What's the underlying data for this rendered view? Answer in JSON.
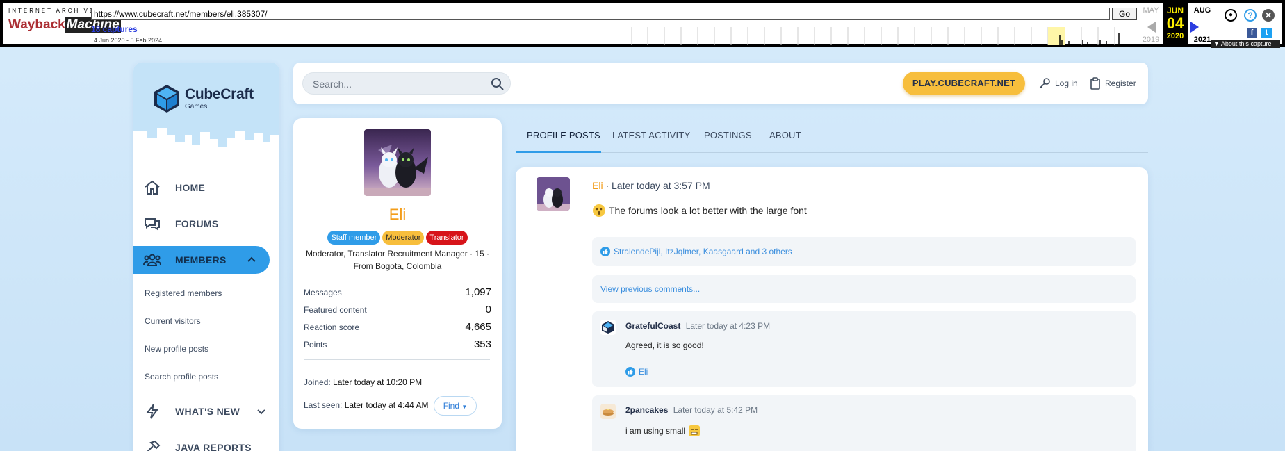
{
  "wayback": {
    "brand_top": "INTERNET ARCHIVE",
    "brand_word1": "Wayback",
    "brand_word2": "Machine",
    "url": "https://www.cubecraft.net/members/eli.385307/",
    "go_label": "Go",
    "captures": "18 captures",
    "date_range": "4 Jun 2020 - 5 Feb 2024",
    "prev_month": "MAY",
    "prev_year": "2019",
    "cur_month": "JUN",
    "cur_day": "04",
    "cur_year": "2020",
    "next_month": "AUG",
    "next_year": "2021",
    "about": "▼ About this capture",
    "icons": [
      "user-icon",
      "help-icon",
      "close-icon",
      "facebook-icon",
      "twitter-icon"
    ]
  },
  "brand": {
    "line1": "CubeCraft",
    "line2": "Games",
    "accent": "#2f9ce8",
    "gold": "#f7be3c"
  },
  "nav": {
    "home": "HOME",
    "forums": "FORUMS",
    "members": "MEMBERS",
    "members_sub": [
      "Registered members",
      "Current visitors",
      "New profile posts",
      "Search profile posts"
    ],
    "whats_new": "WHAT'S NEW",
    "java_reports": "JAVA REPORTS"
  },
  "header": {
    "search_placeholder": "Search...",
    "play": "PLAY.CUBECRAFT.NET",
    "login": "Log in",
    "register": "Register"
  },
  "profile": {
    "name": "Eli",
    "badges": [
      "Staff member",
      "Moderator",
      "Translator"
    ],
    "title_line": "Moderator, Translator Recruitment Manager · 15 · From Bogota, Colombia",
    "stats": [
      {
        "label": "Messages",
        "value": "1,097"
      },
      {
        "label": "Featured content",
        "value": "0"
      },
      {
        "label": "Reaction score",
        "value": "4,665"
      },
      {
        "label": "Points",
        "value": "353"
      }
    ],
    "joined_label": "Joined:",
    "joined_value": "Later today at 10:20 PM",
    "last_seen_label": "Last seen:",
    "last_seen_value": "Later today at 4:44 AM",
    "find": "Find"
  },
  "tabs": [
    "PROFILE POSTS",
    "LATEST ACTIVITY",
    "POSTINGS",
    "ABOUT"
  ],
  "post": {
    "author": "Eli",
    "time": " · Later today at 3:57 PM",
    "body": "The forums look a lot better with the large font",
    "reactions": "StralendePijl, ItzJqlmer, Kaasgaard and 3 others",
    "view_previous": "View previous comments...",
    "comments": [
      {
        "user": "GratefulCoast",
        "time": "Later today at 4:23 PM",
        "body": "Agreed, it is so good!",
        "reaction": "Eli"
      },
      {
        "user": "2pancakes",
        "time": "Later today at 5:42 PM",
        "body": "i am using small"
      }
    ]
  }
}
